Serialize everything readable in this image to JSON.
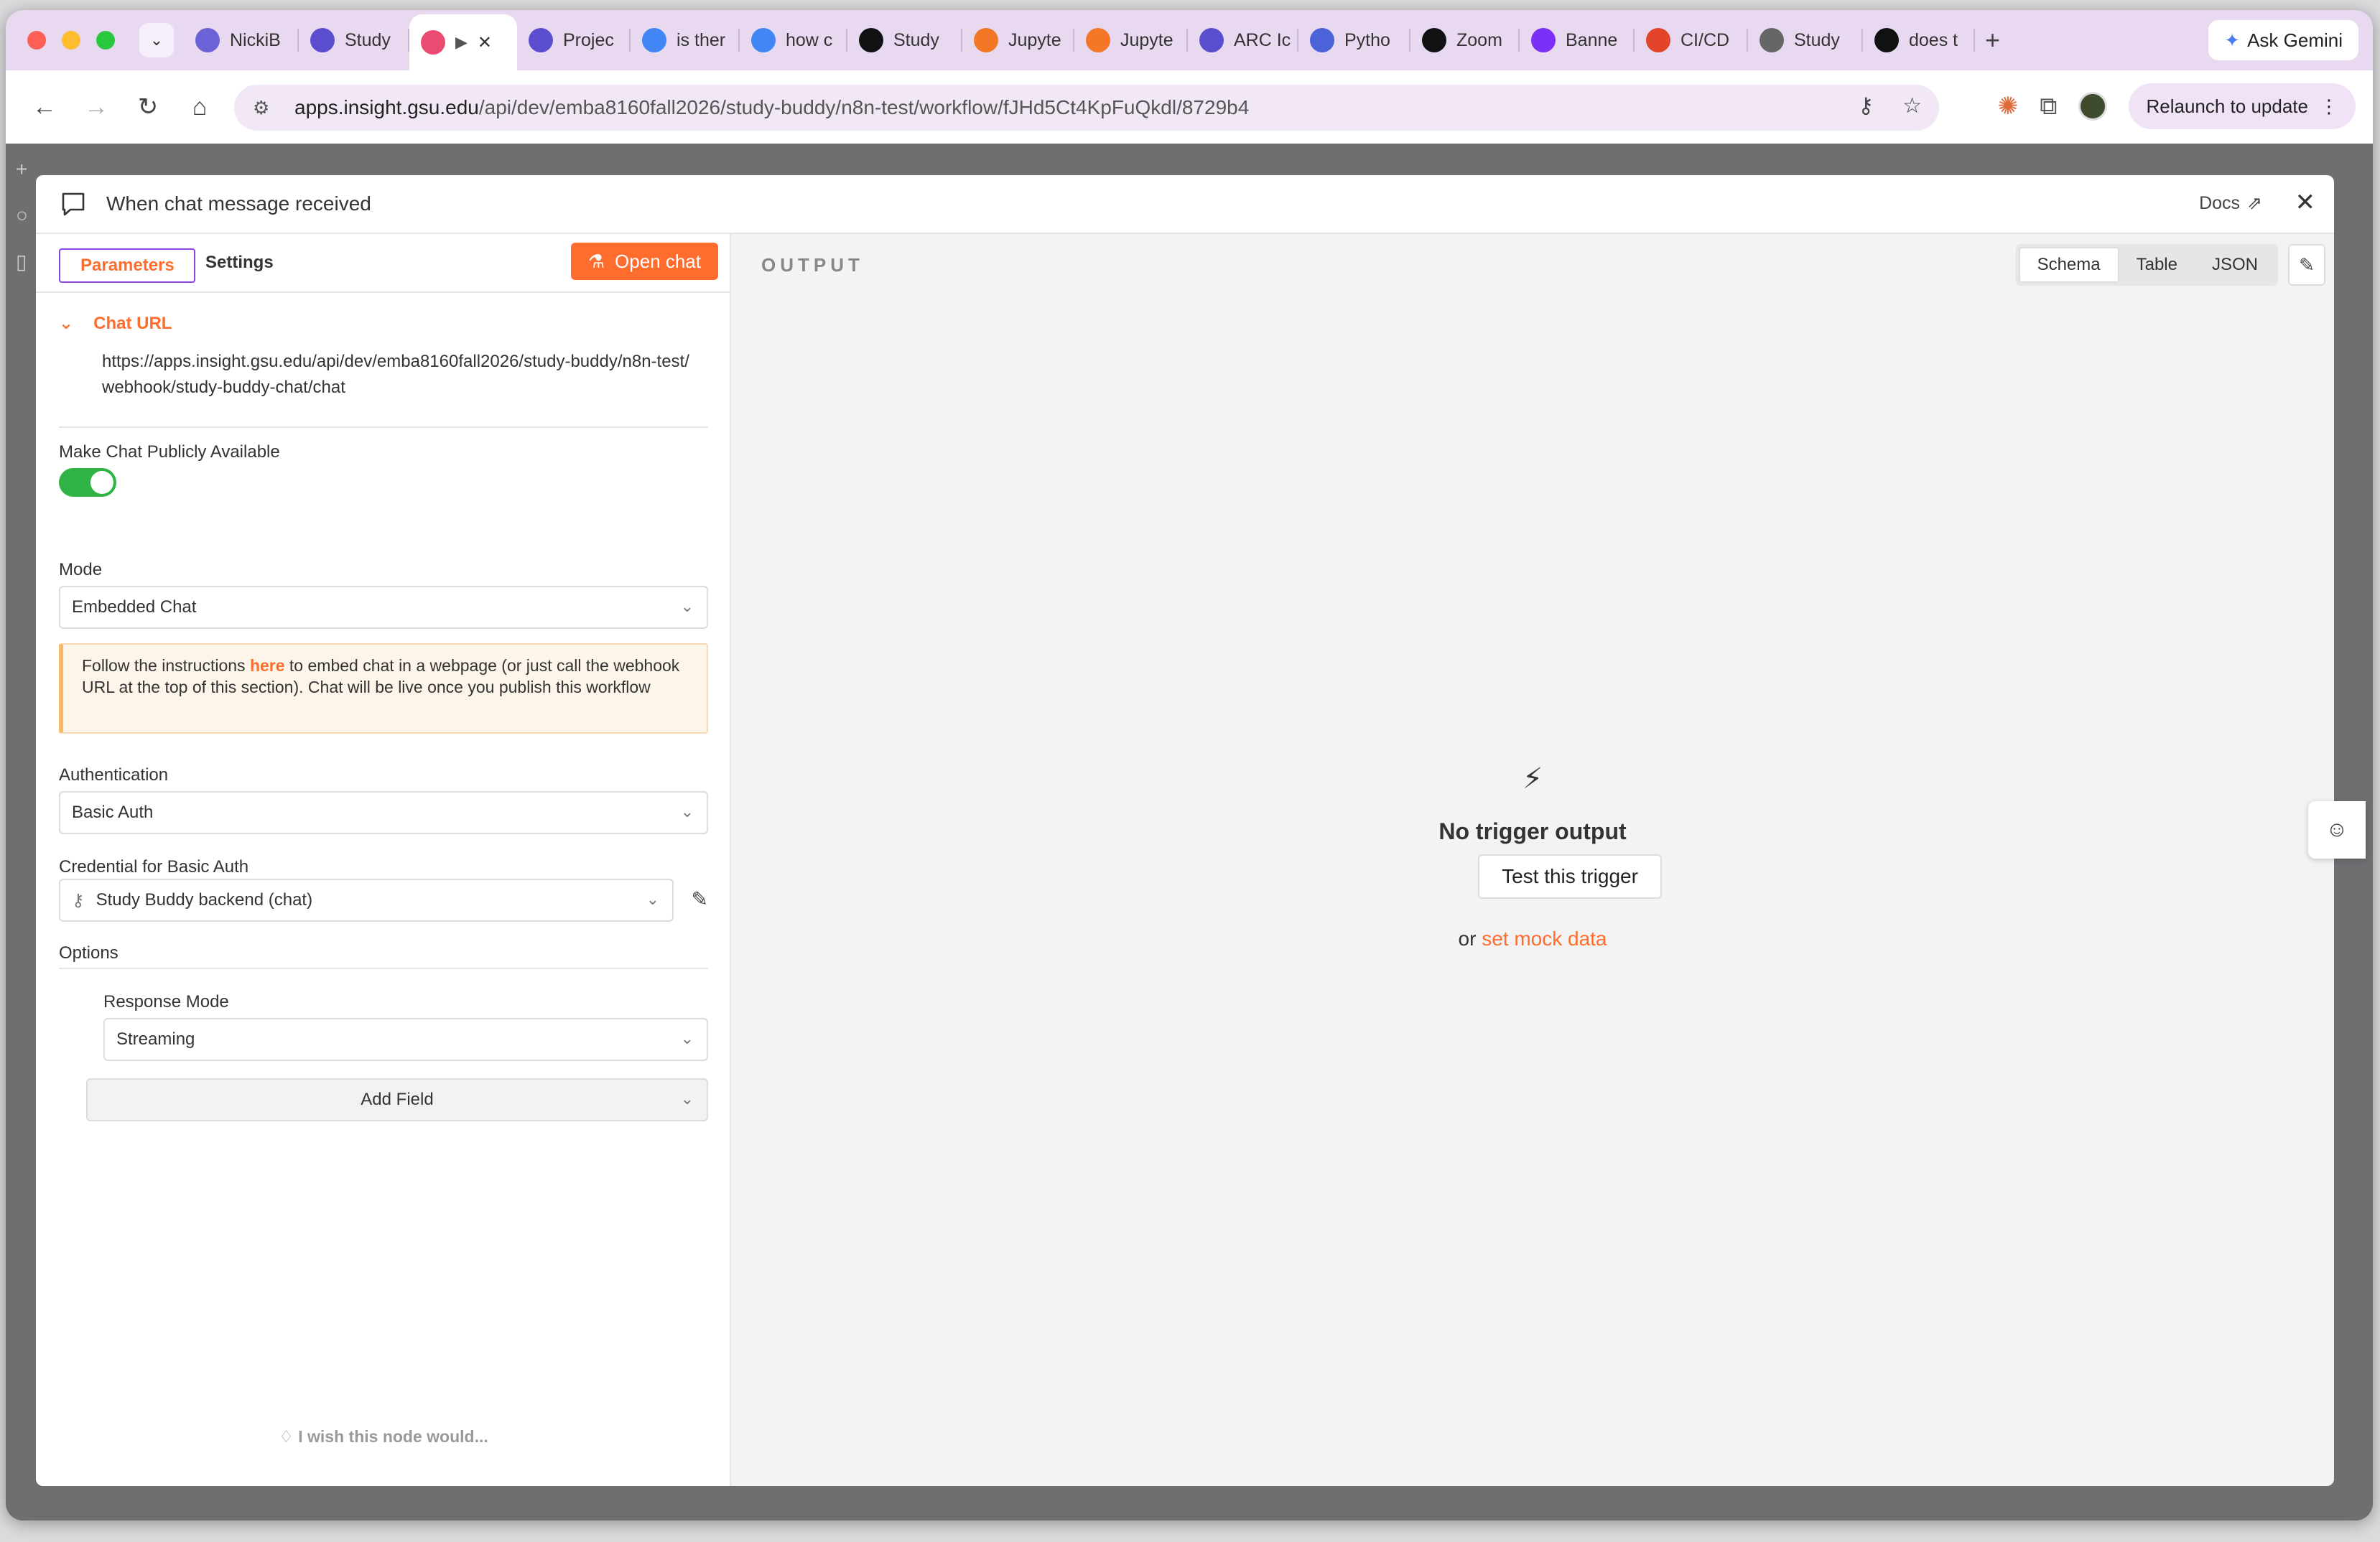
{
  "browser": {
    "tabs": [
      {
        "label": "NickiB",
        "icon": "bot-favicon",
        "color": "#6a62d6"
      },
      {
        "label": "Study",
        "icon": "gsu-favicon",
        "color": "#5b4fcf"
      },
      {
        "label": "",
        "icon": "n8n-favicon",
        "color": "#ea4b71",
        "active": true
      },
      {
        "label": "Projec",
        "icon": "gsu-favicon",
        "color": "#5b4fcf"
      },
      {
        "label": "is ther",
        "icon": "google-favicon",
        "color": "#4285f4"
      },
      {
        "label": "how c",
        "icon": "google-favicon",
        "color": "#4285f4"
      },
      {
        "label": "Study",
        "icon": "chatgpt-favicon",
        "color": "#111111"
      },
      {
        "label": "Jupyte",
        "icon": "jupyter-favicon",
        "color": "#f37726"
      },
      {
        "label": "Jupyte",
        "icon": "jupyter-favicon",
        "color": "#f37726"
      },
      {
        "label": "ARC Ic",
        "icon": "gsu-favicon",
        "color": "#5b4fcf"
      },
      {
        "label": "Pytho",
        "icon": "arc-favicon",
        "color": "#4b62d8"
      },
      {
        "label": "Zoom",
        "icon": "zoom-favicon",
        "color": "#111111"
      },
      {
        "label": "Banne",
        "icon": "banner-favicon",
        "color": "#7b2ff7"
      },
      {
        "label": "CI/CD",
        "icon": "gitlab-favicon",
        "color": "#e24329"
      },
      {
        "label": "Study",
        "icon": "globe-favicon",
        "color": "#666666"
      },
      {
        "label": "does t",
        "icon": "chatgpt-favicon",
        "color": "#111111"
      }
    ],
    "ask_gemini": "Ask Gemini",
    "url_host": "apps.insight.gsu.edu",
    "url_path": "/api/dev/emba8160fall2026/study-buddy/n8n-test/workflow/fJHd5Ct4KpFuQkdl/8729b4",
    "relaunch": "Relaunch to update"
  },
  "modal": {
    "title": "When chat message received",
    "docs": "Docs",
    "tabs": {
      "parameters": "Parameters",
      "settings": "Settings"
    },
    "open_chat": "Open chat",
    "chat_url_label": "Chat URL",
    "chat_url_value": "https://apps.insight.gsu.edu/api/dev/emba8160fall2026/study-buddy/n8n-test/webhook/study-buddy-chat/chat",
    "public_label": "Make Chat Publicly Available",
    "public_enabled": true,
    "mode_label": "Mode",
    "mode_value": "Embedded Chat",
    "notice_prefix": "Follow the instructions ",
    "notice_link": "here",
    "notice_suffix": " to embed chat in a webpage (or just call the webhook URL at the top of this section). Chat will be live once you publish this workflow",
    "auth_label": "Authentication",
    "auth_value": "Basic Auth",
    "cred_label": "Credential for Basic Auth",
    "cred_value": "Study Buddy backend (chat)",
    "options_label": "Options",
    "response_mode_label": "Response Mode",
    "response_mode_value": "Streaming",
    "add_field": "Add Field",
    "wish": "I wish this node would..."
  },
  "output": {
    "label": "OUTPUT",
    "views": [
      "Schema",
      "Table",
      "JSON"
    ],
    "active_view": "Schema",
    "empty_title": "No trigger output",
    "test_button": "Test this trigger",
    "mock_prefix": "or ",
    "mock_link": "set mock data"
  },
  "colors": {
    "accent": "#ff6d2e",
    "toggle_on": "#2fb344",
    "tab_bar": "#e9d9f0"
  }
}
